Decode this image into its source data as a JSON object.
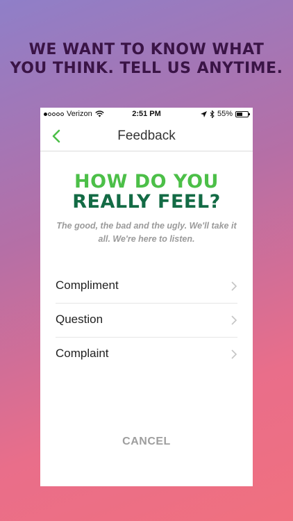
{
  "banner": {
    "line1": "WE WANT TO KNOW WHAT",
    "line2": "YOU THINK. TELL US ANYTIME."
  },
  "status_bar": {
    "carrier": "Verizon",
    "time": "2:51 PM",
    "battery": "55%",
    "battery_level": 0.55,
    "signal_bars": 1
  },
  "nav": {
    "title": "Feedback",
    "back_icon": "chevron-left-icon"
  },
  "hero": {
    "line1": "HOW DO YOU",
    "line2": "REALLY FEEL?"
  },
  "subtitle": {
    "line1": "The good, the bad and the ugly.  We'll take it",
    "line2": "all.  We're here to listen."
  },
  "menu": [
    {
      "label": "Compliment"
    },
    {
      "label": "Question"
    },
    {
      "label": "Complaint"
    }
  ],
  "cancel_label": "CANCEL",
  "colors": {
    "banner_text": "#3a1446",
    "hero_green": "#4cbf48",
    "hero_dark_green": "#136b45",
    "accent_green": "#4cbf48",
    "cancel_gray": "#9e9e9e"
  }
}
